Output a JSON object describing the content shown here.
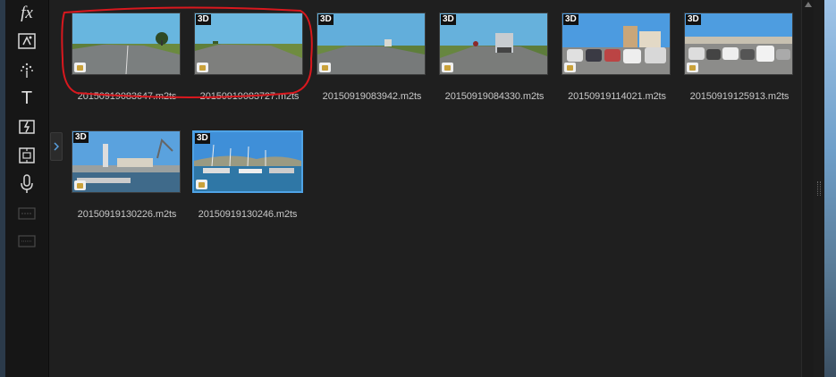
{
  "toolbar": {
    "tools": [
      {
        "name": "fx-tool-icon",
        "label": "fx"
      },
      {
        "name": "particle-tool-icon"
      },
      {
        "name": "magic-tool-icon"
      },
      {
        "name": "text-tool-icon",
        "label": "T"
      },
      {
        "name": "transition-tool-icon"
      },
      {
        "name": "pip-tool-icon"
      },
      {
        "name": "microphone-tool-icon"
      },
      {
        "name": "subtitle-tool-icon",
        "disabled": true
      },
      {
        "name": "chapter-tool-icon",
        "disabled": true
      }
    ]
  },
  "clips": [
    {
      "filename": "20150919083647.m2ts",
      "badge": "",
      "scene": "road"
    },
    {
      "filename": "20150919083727.m2ts",
      "badge": "3D",
      "scene": "road"
    },
    {
      "filename": "20150919083942.m2ts",
      "badge": "3D",
      "scene": "road"
    },
    {
      "filename": "20150919084330.m2ts",
      "badge": "3D",
      "scene": "truck"
    },
    {
      "filename": "20150919114021.m2ts",
      "badge": "3D",
      "scene": "parking"
    },
    {
      "filename": "20150919125913.m2ts",
      "badge": "3D",
      "scene": "parking"
    },
    {
      "filename": "20150919130226.m2ts",
      "badge": "3D",
      "scene": "harbor"
    },
    {
      "filename": "20150919130246.m2ts",
      "badge": "3D",
      "scene": "marina",
      "selected": true
    }
  ],
  "colors": {
    "annotation": "#d9181e",
    "selection": "#4fa3e6"
  }
}
